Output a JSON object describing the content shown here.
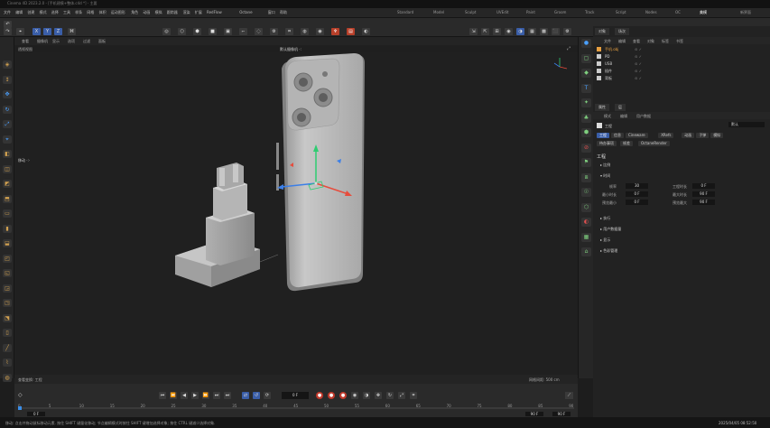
{
  "window": {
    "title": "Cinema 4D 2023.2.0 - [手机建模+整体.c4d *] - 主要"
  },
  "menubar": {
    "items": [
      "文件",
      "编辑",
      "创建",
      "模式",
      "选择",
      "工具",
      "样条",
      "网格",
      "体积",
      "运动图形",
      "角色",
      "动画",
      "模拟",
      "跟踪器",
      "渲染",
      "扩展",
      "RedFlow",
      "Octane",
      "窗口",
      "帮助"
    ],
    "layouts": [
      "Standard",
      "Model",
      "Sculpt",
      "UVEdit",
      "Paint",
      "Groom",
      "Track",
      "Script",
      "Nodes",
      "OC",
      "美模",
      "新界面"
    ],
    "active_layout": "美模"
  },
  "toolbar": {
    "axis_labels": [
      "X",
      "Y",
      "Z"
    ],
    "mid_icons": [
      "◎",
      "⬡",
      "⬢",
      "■",
      "▣",
      "⌐",
      "◌",
      "⚙",
      "⌗",
      "◍",
      "◉",
      "♆",
      "▤",
      "◐"
    ],
    "right_icons": [
      "⇲",
      "⇱",
      "⊞",
      "◉",
      "◑",
      "▦",
      "▩",
      "⬛",
      "⚙"
    ]
  },
  "viewport": {
    "menus": [
      "查看",
      "摄像机",
      "显示",
      "选项",
      "过滤",
      "面板"
    ],
    "view_name": "透视视图",
    "camera_label": "默认摄像机 ·:",
    "move_label": "移动 ·:·",
    "footer_left": "查看变换: 工程",
    "grid_spacing": "网格间距: 500 cm"
  },
  "timeline": {
    "ruler": [
      "0",
      "5",
      "10",
      "15",
      "20",
      "25",
      "30",
      "35",
      "40",
      "45",
      "50",
      "55",
      "60",
      "65",
      "70",
      "75",
      "80",
      "85",
      "90"
    ],
    "current_frame": "0 F",
    "start_field": "0 F",
    "end_fields": [
      "90 F",
      "90 F"
    ],
    "playhead_fraction": 0
  },
  "status": {
    "message": "移动: 点击并拖动鼠标移动元素. 按住 SHIFT 键量化移动; 节点编辑模式时按住 SHIFT 键增加选择对象; 按住 CTRL 键减少选择对象.",
    "datetime": "2025/04/05 08:52:50"
  },
  "objects": {
    "tabs": [
      "对象",
      "场次"
    ],
    "menu": [
      "文件",
      "编辑",
      "查看",
      "对象",
      "标签",
      "书签"
    ],
    "rows": [
      {
        "name": "手机.obj",
        "color": "#e8a040"
      },
      {
        "name": "PD",
        "color": "#cccccc"
      },
      {
        "name": "USB",
        "color": "#cccccc"
      },
      {
        "name": "插件",
        "color": "#cccccc"
      },
      {
        "name": "背板",
        "color": "#cccccc"
      }
    ]
  },
  "attributes": {
    "tabs": [
      "属性",
      "层"
    ],
    "menu": [
      "模式",
      "编辑",
      "用户数据"
    ],
    "preset": "默认",
    "object_name": "工程",
    "chips": [
      "工程",
      "信息",
      "Cineware",
      "XRefs",
      "动画",
      "子弹",
      "模拟"
    ],
    "chips2": [
      "待办事项",
      "帧差",
      "OctaneRender"
    ],
    "active_chip": "工程",
    "section_title": "工程",
    "groups": [
      "比例",
      "时间",
      "执行",
      "用户数据量",
      "显示",
      "色彩管理"
    ],
    "fields": [
      {
        "label": "帧率",
        "value": "30",
        "label2": "工程时长",
        "value2": "0 F"
      },
      {
        "label": "最小时长",
        "value": "0 F",
        "label2": "最大时长",
        "value2": "90 F"
      },
      {
        "label": "预览最小",
        "value": "0 F",
        "label2": "预览最大",
        "value2": "90 F"
      }
    ]
  },
  "lefttools": [
    "◈",
    "↕",
    "✥",
    "↻",
    "⤢",
    "⌖",
    "◧",
    "◫",
    "◩",
    "⬒",
    "▭",
    "▮",
    "⬓",
    "◰",
    "◱",
    "◲",
    "◳",
    "⬔",
    "▯",
    "╱",
    "⌇",
    "◍"
  ],
  "midtools": [
    "●",
    "▢",
    "◆",
    "T",
    "✦",
    "♣",
    "⬢",
    "⊘",
    "⚑",
    "⧈",
    "☉",
    "⬡",
    "◐",
    "▦",
    "⌂"
  ]
}
